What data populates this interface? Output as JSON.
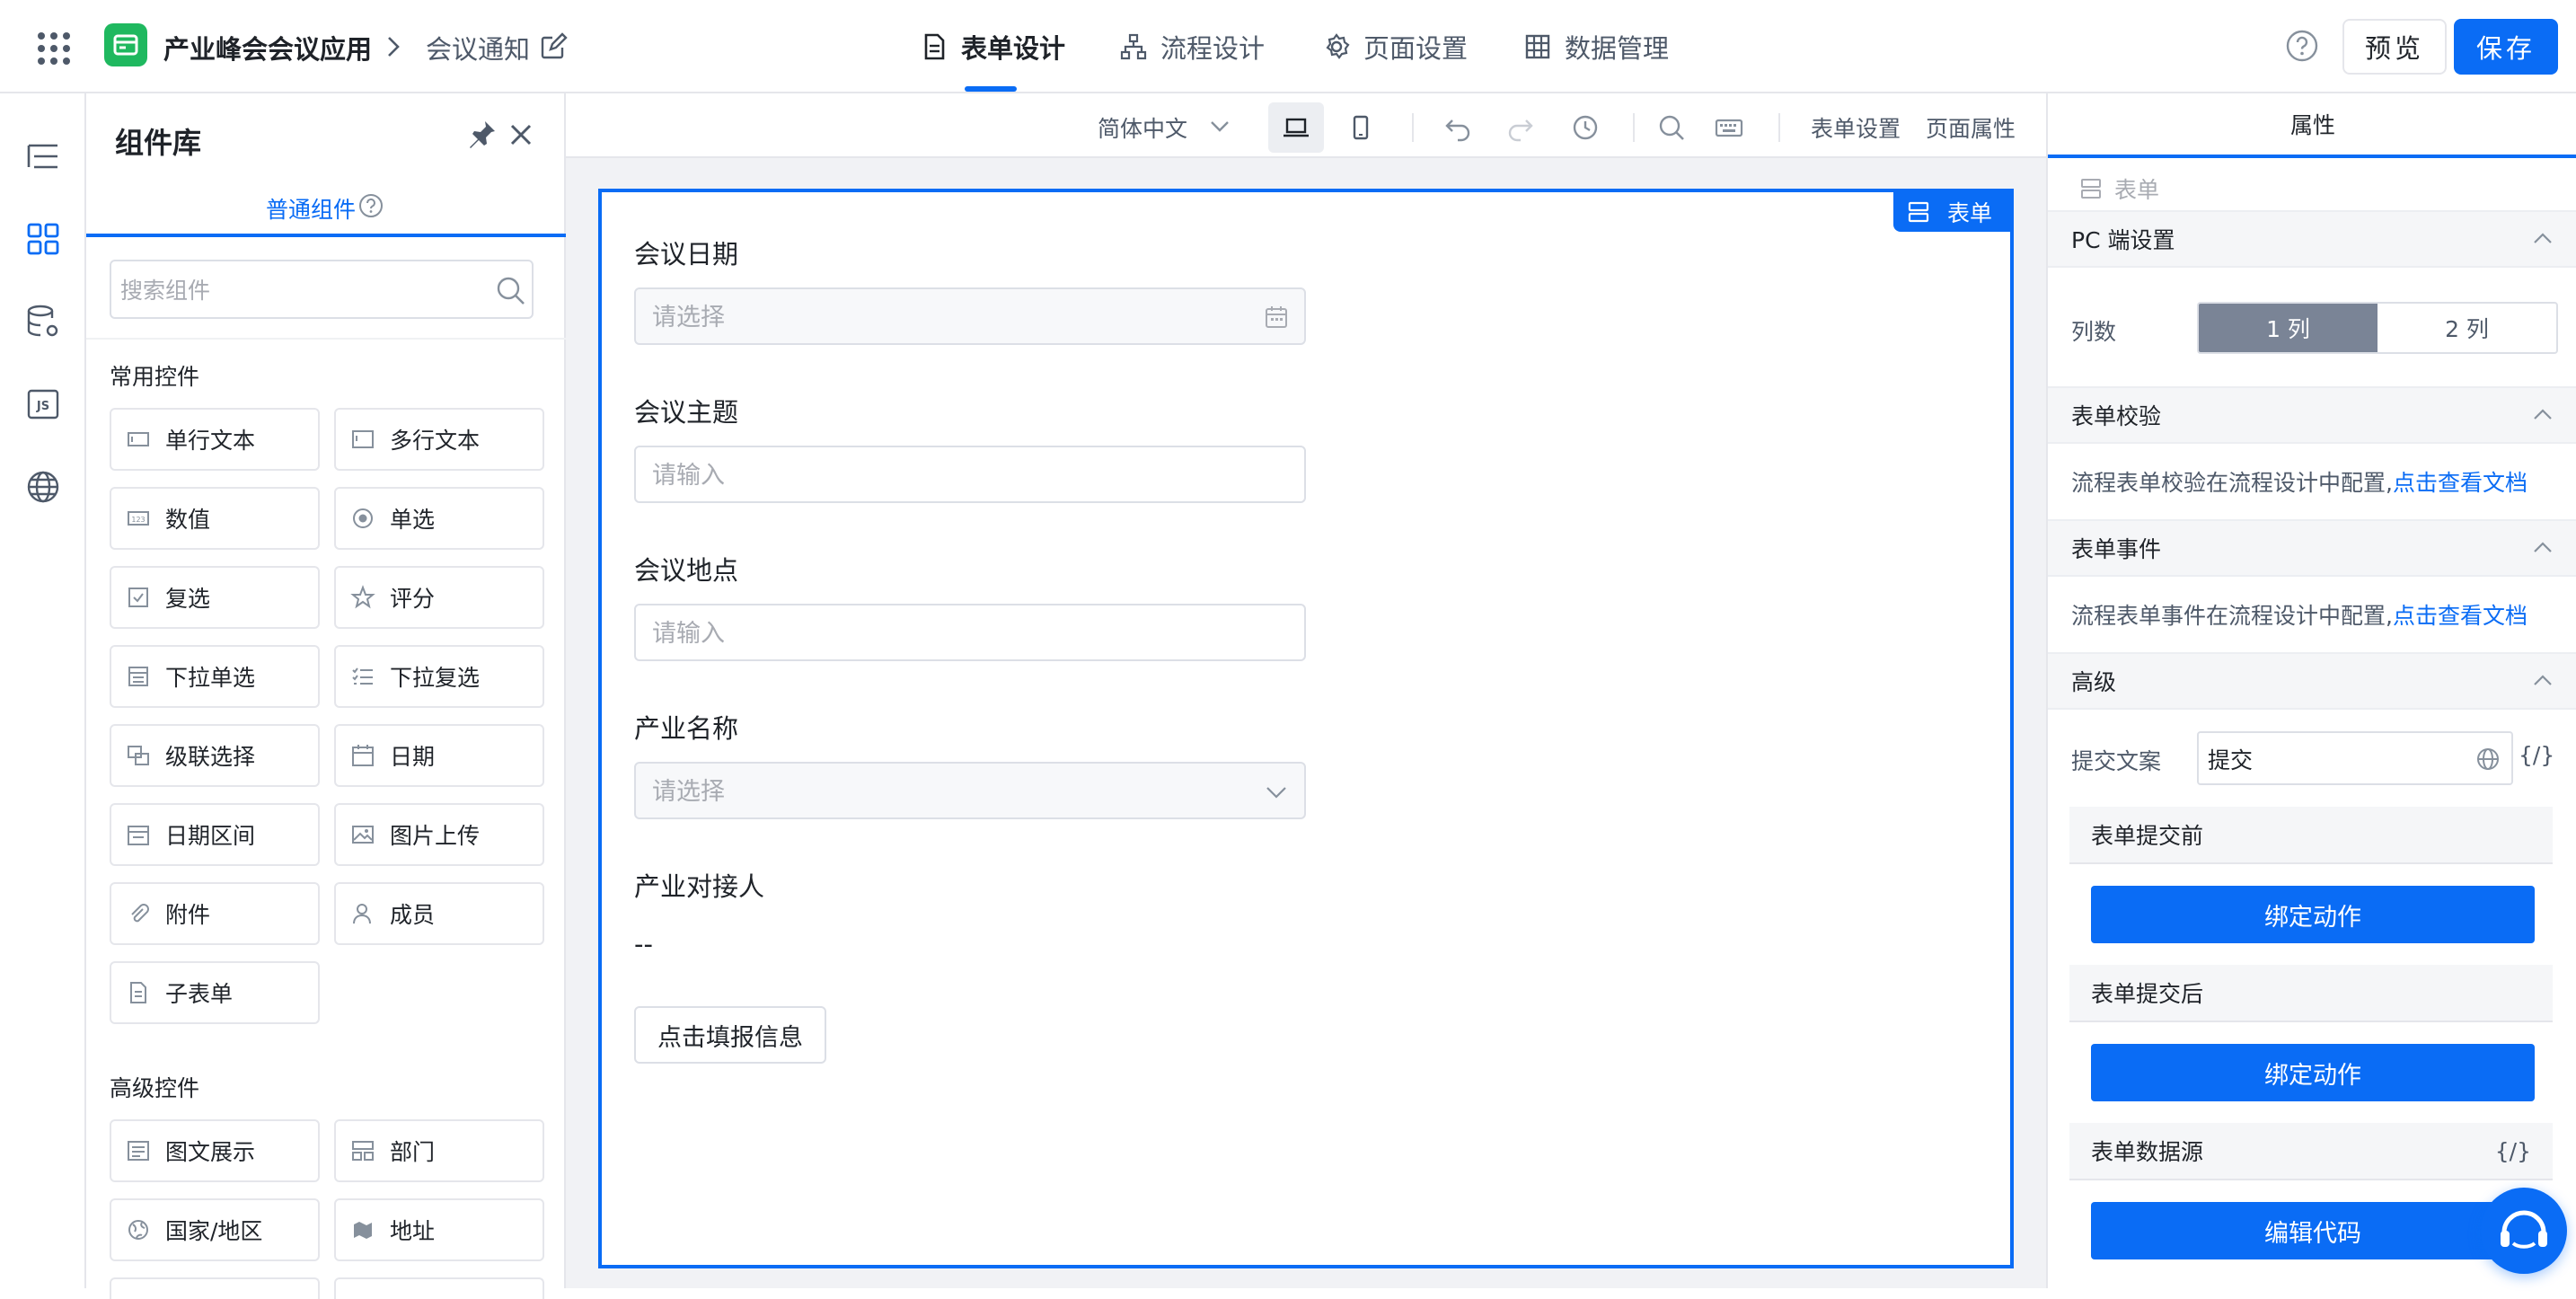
{
  "header": {
    "app_name": "产业峰会会议应用",
    "page_name": "会议通知",
    "tabs": [
      {
        "label": "表单设计",
        "active": true,
        "icon": "form-doc-icon"
      },
      {
        "label": "流程设计",
        "active": false,
        "icon": "flow-icon"
      },
      {
        "label": "页面设置",
        "active": false,
        "icon": "gear-icon"
      },
      {
        "label": "数据管理",
        "active": false,
        "icon": "table-grid-icon"
      }
    ],
    "preview_label": "预览",
    "save_label": "保存"
  },
  "left_nav": {
    "items": [
      "outline-icon",
      "components-grid-icon",
      "data-source-icon",
      "js-icon",
      "globe-icon"
    ],
    "active_index": 1
  },
  "library": {
    "title": "组件库",
    "tab_label": "普通组件",
    "search_placeholder": "搜索组件",
    "common_title": "常用控件",
    "common_items": [
      {
        "label": "单行文本",
        "icon": "single-line-text-icon"
      },
      {
        "label": "多行文本",
        "icon": "multi-line-text-icon"
      },
      {
        "label": "数值",
        "icon": "number-icon"
      },
      {
        "label": "单选",
        "icon": "radio-icon"
      },
      {
        "label": "复选",
        "icon": "checkbox-icon"
      },
      {
        "label": "评分",
        "icon": "star-icon"
      },
      {
        "label": "下拉单选",
        "icon": "dropdown-single-icon"
      },
      {
        "label": "下拉复选",
        "icon": "dropdown-multi-icon"
      },
      {
        "label": "级联选择",
        "icon": "cascade-icon"
      },
      {
        "label": "日期",
        "icon": "calendar-icon"
      },
      {
        "label": "日期区间",
        "icon": "date-range-icon"
      },
      {
        "label": "图片上传",
        "icon": "image-upload-icon"
      },
      {
        "label": "附件",
        "icon": "paperclip-icon"
      },
      {
        "label": "成员",
        "icon": "member-icon"
      },
      {
        "label": "子表单",
        "icon": "subform-icon"
      }
    ],
    "advanced_title": "高级控件",
    "advanced_items": [
      {
        "label": "图文展示",
        "icon": "rich-text-icon"
      },
      {
        "label": "部门",
        "icon": "department-icon"
      },
      {
        "label": "国家/地区",
        "icon": "globe-icon"
      },
      {
        "label": "地址",
        "icon": "map-icon"
      }
    ]
  },
  "canvas_toolbar": {
    "language": "简体中文",
    "form_settings": "表单设置",
    "page_properties": "页面属性"
  },
  "form": {
    "badge": "表单",
    "fields": [
      {
        "label": "会议日期",
        "placeholder": "请选择",
        "type": "date"
      },
      {
        "label": "会议主题",
        "placeholder": "请输入",
        "type": "text"
      },
      {
        "label": "会议地点",
        "placeholder": "请输入",
        "type": "text"
      },
      {
        "label": "产业名称",
        "placeholder": "请选择",
        "type": "select"
      }
    ],
    "contact_label": "产业对接人",
    "contact_value": "--",
    "action_button": "点击填报信息"
  },
  "props": {
    "tab": "属性",
    "crumb": "表单",
    "pc_title": "PC 端设置",
    "columns_label": "列数",
    "columns_options": [
      "1 列",
      "2 列"
    ],
    "columns_selected": 0,
    "validate_title": "表单校验",
    "validate_text": "流程表单校验在流程设计中配置,",
    "validate_link": "点击查看文档",
    "event_title": "表单事件",
    "event_text": "流程表单事件在流程设计中配置,",
    "event_link": "点击查看文档",
    "advanced_title": "高级",
    "submit_label": "提交文案",
    "submit_value": "提交",
    "fx": "{/}",
    "before_submit": "表单提交前",
    "after_submit": "表单提交后",
    "bind_action": "绑定动作",
    "datasource_title": "表单数据源",
    "edit_code": "编辑代码"
  }
}
